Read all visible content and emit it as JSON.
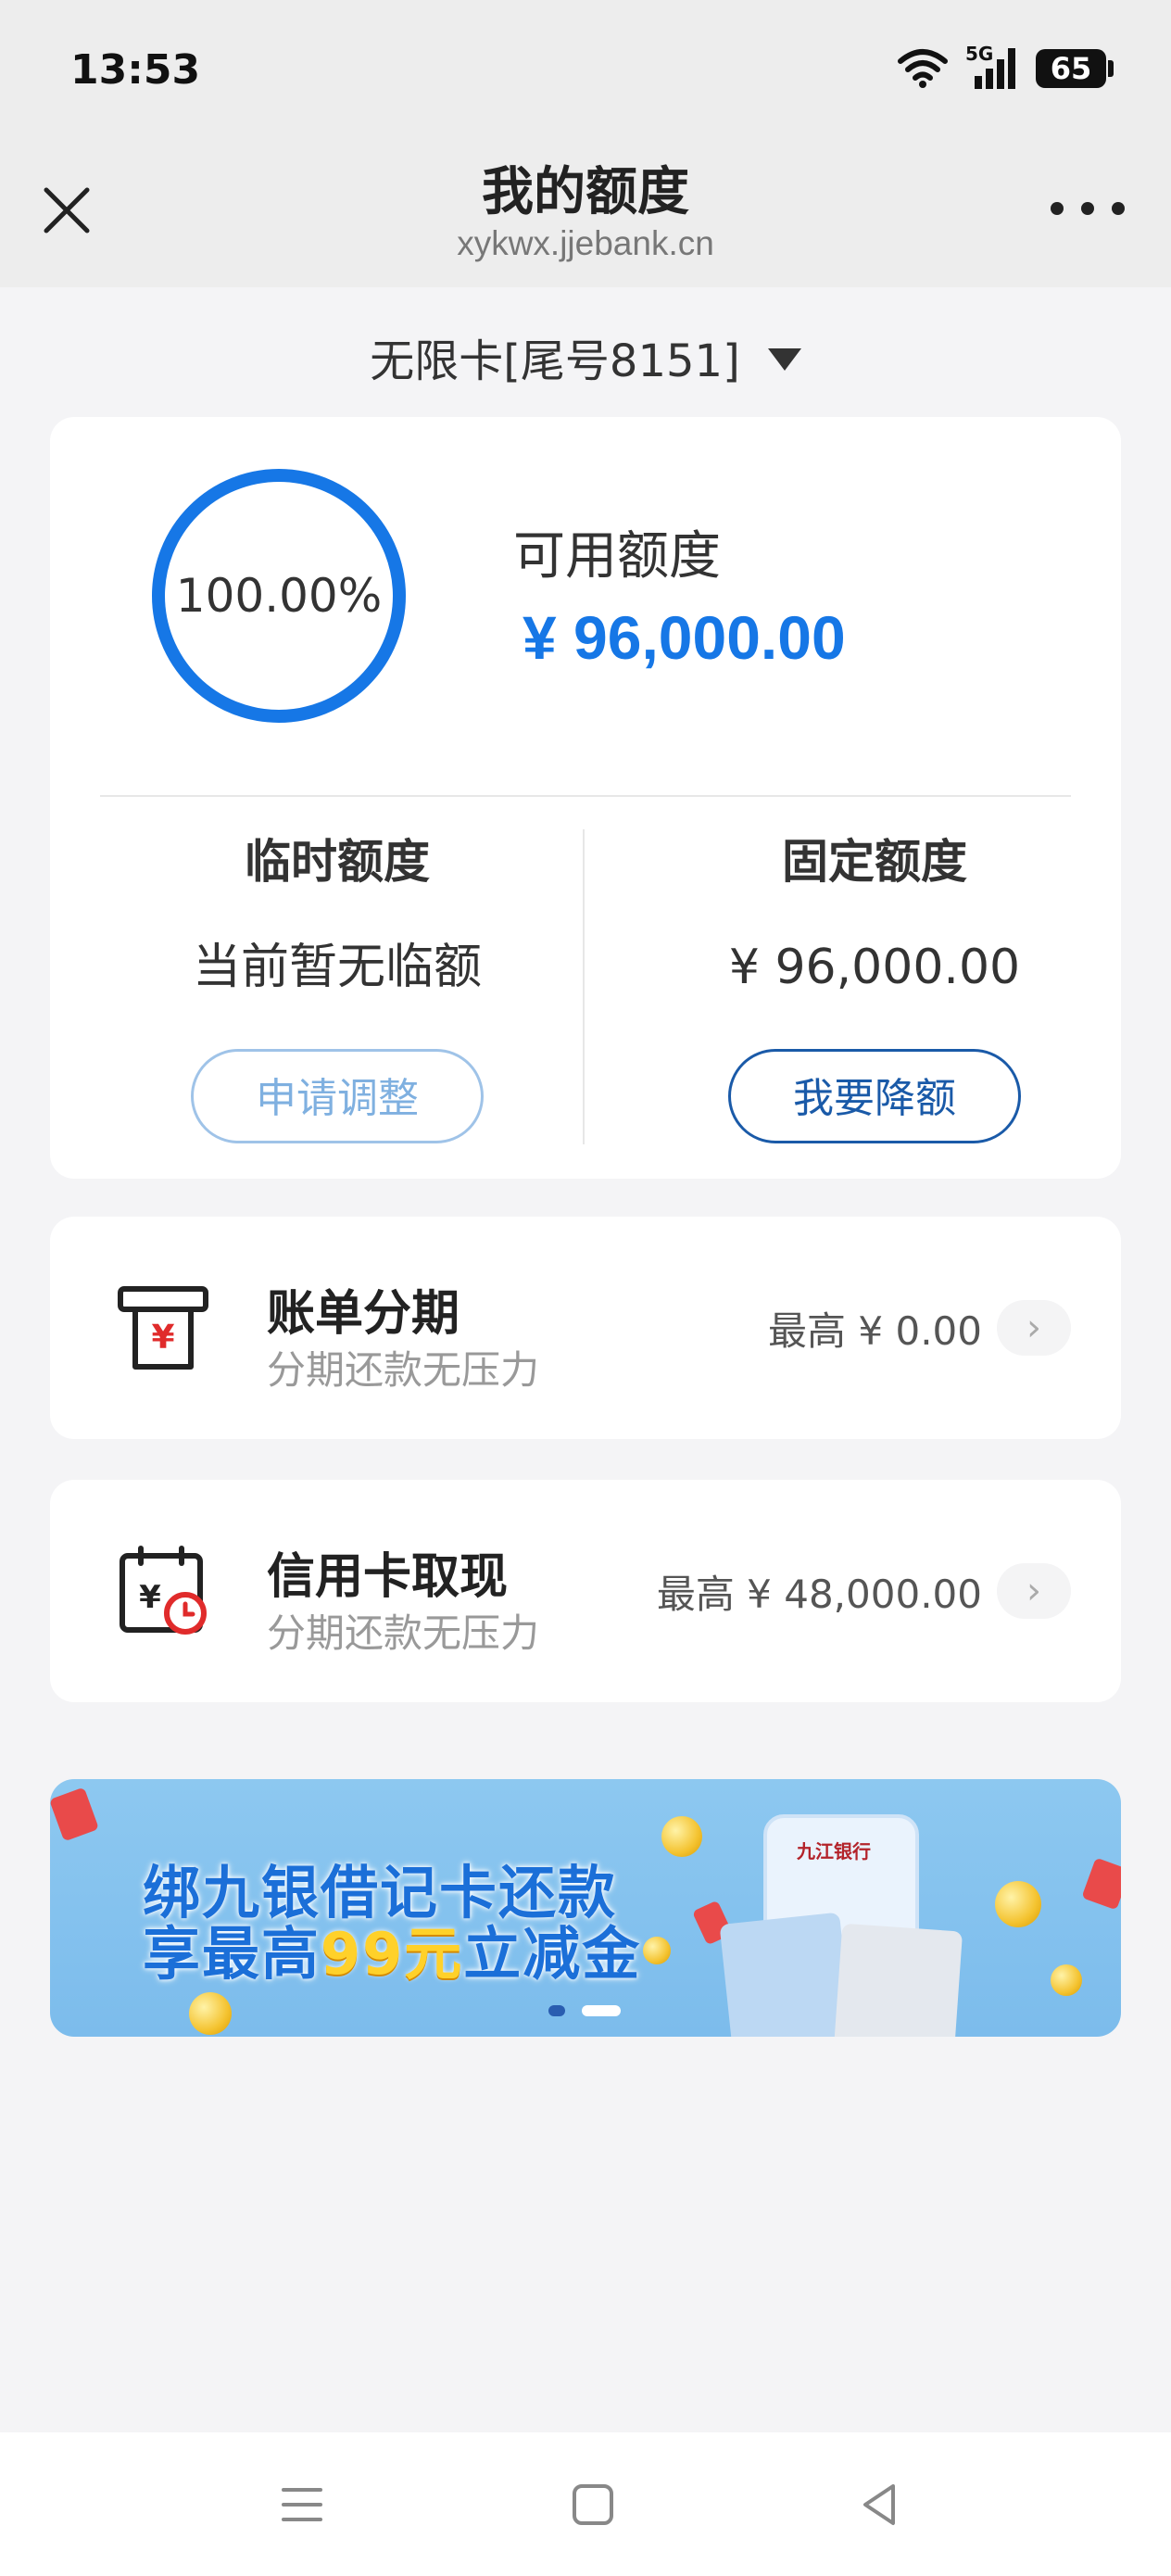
{
  "status_bar": {
    "time": "13:53",
    "network": "5G",
    "battery": "65"
  },
  "nav": {
    "title": "我的额度",
    "subtitle": "xykwx.jjebank.cn"
  },
  "card_selector": {
    "label": "无限卡[尾号8151]"
  },
  "quota": {
    "percent_label": "100.00%",
    "percent_value": 100,
    "available_label": "可用额度",
    "available_amount": "¥ 96,000.00",
    "temp_title": "临时额度",
    "temp_value": "当前暂无临额",
    "fixed_title": "固定额度",
    "fixed_value": "¥ 96,000.00",
    "apply_button": "申请调整",
    "reduce_button": "我要降额"
  },
  "services": [
    {
      "title": "账单分期",
      "subtitle": "分期还款无压力",
      "amount": "最高 ¥ 0.00",
      "icon": "bill-installment-icon"
    },
    {
      "title": "信用卡取现",
      "subtitle": "分期还款无压力",
      "amount": "最高 ¥ 48,000.00",
      "icon": "cash-withdraw-icon"
    }
  ],
  "banner": {
    "line1": "绑九银借记卡还款",
    "line2_prefix": "享最高",
    "line2_highlight": "99元",
    "line2_suffix": "立减金",
    "bank_name": "九江银行"
  },
  "colors": {
    "accent": "#1677e6",
    "dark_blue": "#1a5aa8",
    "background": "#f4f4f6"
  }
}
